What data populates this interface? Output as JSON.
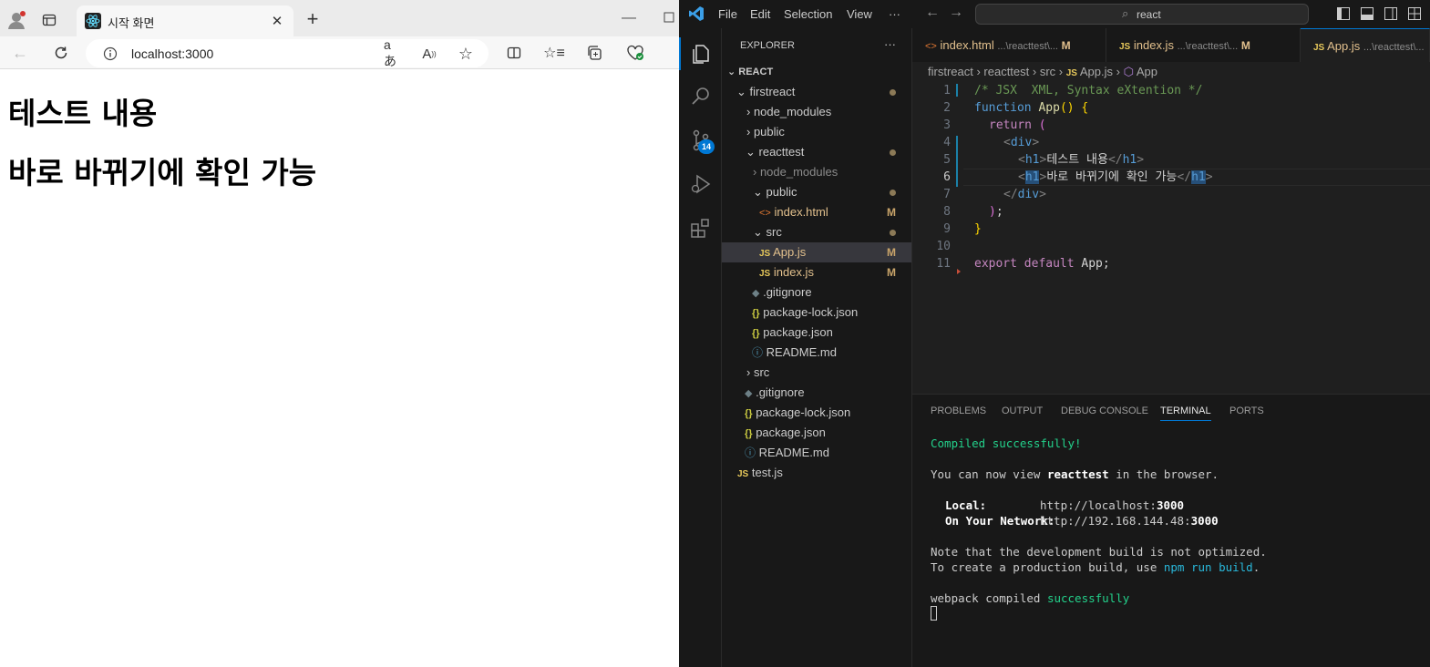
{
  "browser": {
    "tab_title": "시작 화면",
    "url": "localhost:3000",
    "headings": [
      "테스트 내용",
      "바로 바뀌기에 확인 가능"
    ]
  },
  "vscode": {
    "menu": [
      "File",
      "Edit",
      "Selection",
      "View",
      "···"
    ],
    "search_text": "react",
    "scm_badge": "14",
    "explorer": {
      "title": "EXPLORER",
      "more": "···",
      "root": "REACT",
      "items": [
        {
          "label": "firstreact",
          "mark": "dot"
        },
        {
          "label": "node_modules",
          "mark": ""
        },
        {
          "label": "public",
          "mark": ""
        },
        {
          "label": "reacttest",
          "mark": "dot"
        },
        {
          "label": "node_modules",
          "mark": ""
        },
        {
          "label": "public",
          "mark": "dot"
        },
        {
          "label": "index.html",
          "mark": "M"
        },
        {
          "label": "src",
          "mark": "dot"
        },
        {
          "label": "App.js",
          "mark": "M"
        },
        {
          "label": "index.js",
          "mark": "M"
        },
        {
          "label": ".gitignore",
          "mark": ""
        },
        {
          "label": "package-lock.json",
          "mark": ""
        },
        {
          "label": "package.json",
          "mark": ""
        },
        {
          "label": "README.md",
          "mark": ""
        },
        {
          "label": "src",
          "mark": ""
        },
        {
          "label": ".gitignore",
          "mark": ""
        },
        {
          "label": "package-lock.json",
          "mark": ""
        },
        {
          "label": "package.json",
          "mark": ""
        },
        {
          "label": "README.md",
          "mark": ""
        },
        {
          "label": "test.js",
          "mark": ""
        }
      ]
    },
    "editor_tabs": [
      {
        "label": "index.html",
        "path": "...\\reacttest\\...",
        "mark": "M"
      },
      {
        "label": "index.js",
        "path": "...\\reacttest\\...",
        "mark": "M"
      },
      {
        "label": "App.js",
        "path": "...\\reacttest\\..."
      }
    ],
    "breadcrumb": [
      "firstreact",
      "reacttest",
      "src",
      "App.js",
      "App"
    ],
    "code_lines": {
      "l1": "/* JSX  XML, Syntax eXtention */",
      "l2_kw": "function",
      "l2_fn": "App",
      "l3": "return",
      "l5_text": "테스트 내용",
      "l6_text": "바로 바뀌기에 확인 가능",
      "l11_kw": "export default",
      "l11_id": "App;"
    },
    "line_numbers": [
      "1",
      "2",
      "3",
      "4",
      "5",
      "6",
      "7",
      "8",
      "9",
      "10",
      "11"
    ],
    "panel_tabs": [
      "PROBLEMS",
      "OUTPUT",
      "DEBUG CONSOLE",
      "TERMINAL",
      "PORTS"
    ],
    "terminal": {
      "compiled": "Compiled successfully!",
      "view_pre": "You can now view ",
      "view_app": "reacttest",
      "view_post": " in the browser.",
      "local_label": "Local:",
      "local_url_pre": "http://localhost:",
      "local_port": "3000",
      "network_label": "On Your Network:",
      "network_url_pre": "http://192.168.144.48:",
      "network_port": "3000",
      "note1": "Note that the development build is not optimized.",
      "note2_pre": "To create a production build, use ",
      "note2_cmd": "npm run build",
      "note2_post": ".",
      "webpack_pre": "webpack compiled ",
      "webpack_ok": "successfully"
    }
  }
}
